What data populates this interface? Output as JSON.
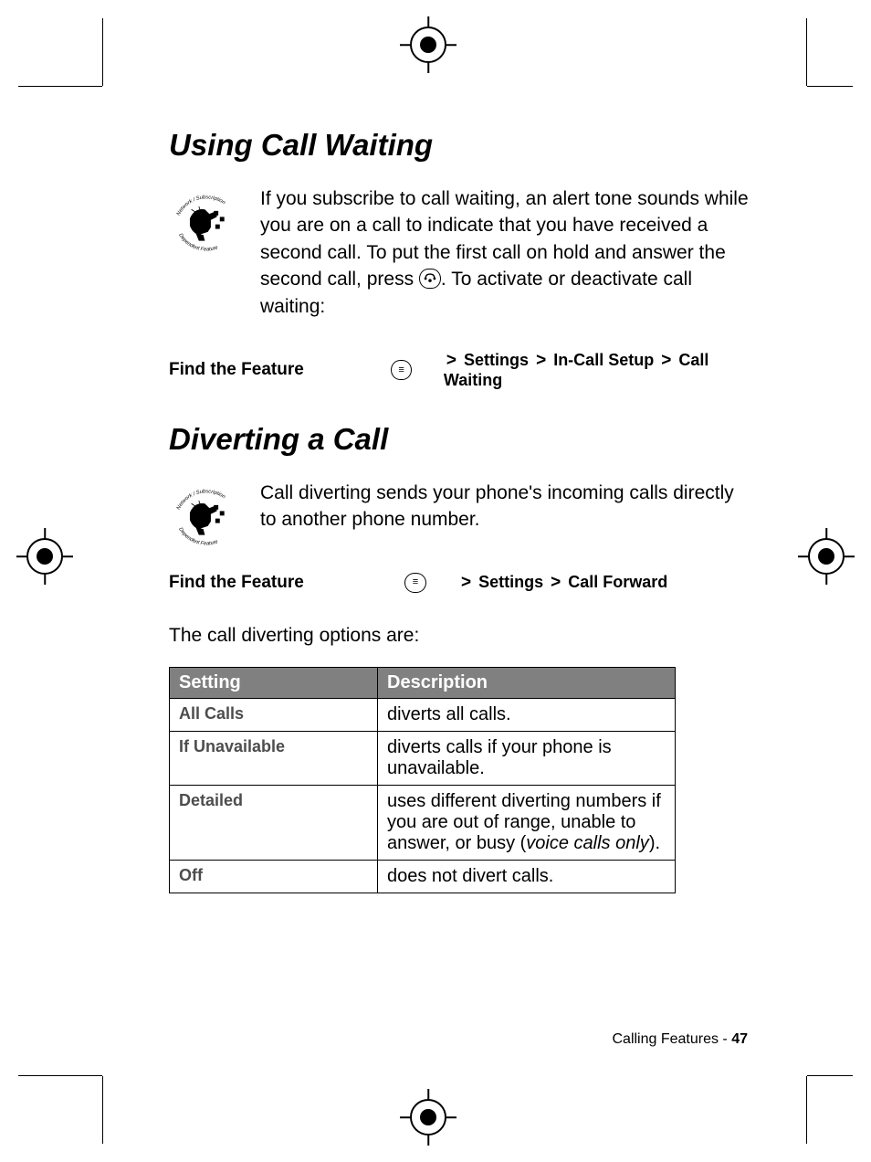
{
  "section1": {
    "heading": "Using Call Waiting",
    "icon_label_top": "Network / Subscription",
    "icon_label_bottom": "Dependent Feature",
    "body_part1": "If you subscribe to call waiting, an alert tone sounds while you are on a call to indicate that you have received a second call. To put the first call on hold and answer the second call, press ",
    "body_part2": ". To activate or deactivate call waiting:",
    "find_label": "Find the Feature",
    "path": [
      "Settings",
      "In-Call Setup",
      "Call Waiting"
    ]
  },
  "section2": {
    "heading": "Diverting a Call",
    "icon_label_top": "Network / Subscription",
    "icon_label_bottom": "Dependent Feature",
    "body": "Call diverting sends your phone's incoming calls directly to another phone number.",
    "find_label": "Find the Feature",
    "path": [
      "Settings",
      "Call Forward"
    ],
    "table_intro": "The call diverting options are:",
    "table": {
      "headers": [
        "Setting",
        "Description"
      ],
      "rows": [
        {
          "setting": "All Calls",
          "desc": "diverts all calls."
        },
        {
          "setting": "If Unavailable",
          "desc": "diverts calls if your phone is unavailable."
        },
        {
          "setting": "Detailed",
          "desc_pre": "uses different diverting numbers if you are out of range, unable to answer, or busy (",
          "desc_italic": "voice calls only",
          "desc_post": ")."
        },
        {
          "setting": "Off",
          "desc": "does not divert calls."
        }
      ]
    }
  },
  "footer": {
    "section_name": "Calling Features",
    "sep": " - ",
    "page": "47"
  }
}
